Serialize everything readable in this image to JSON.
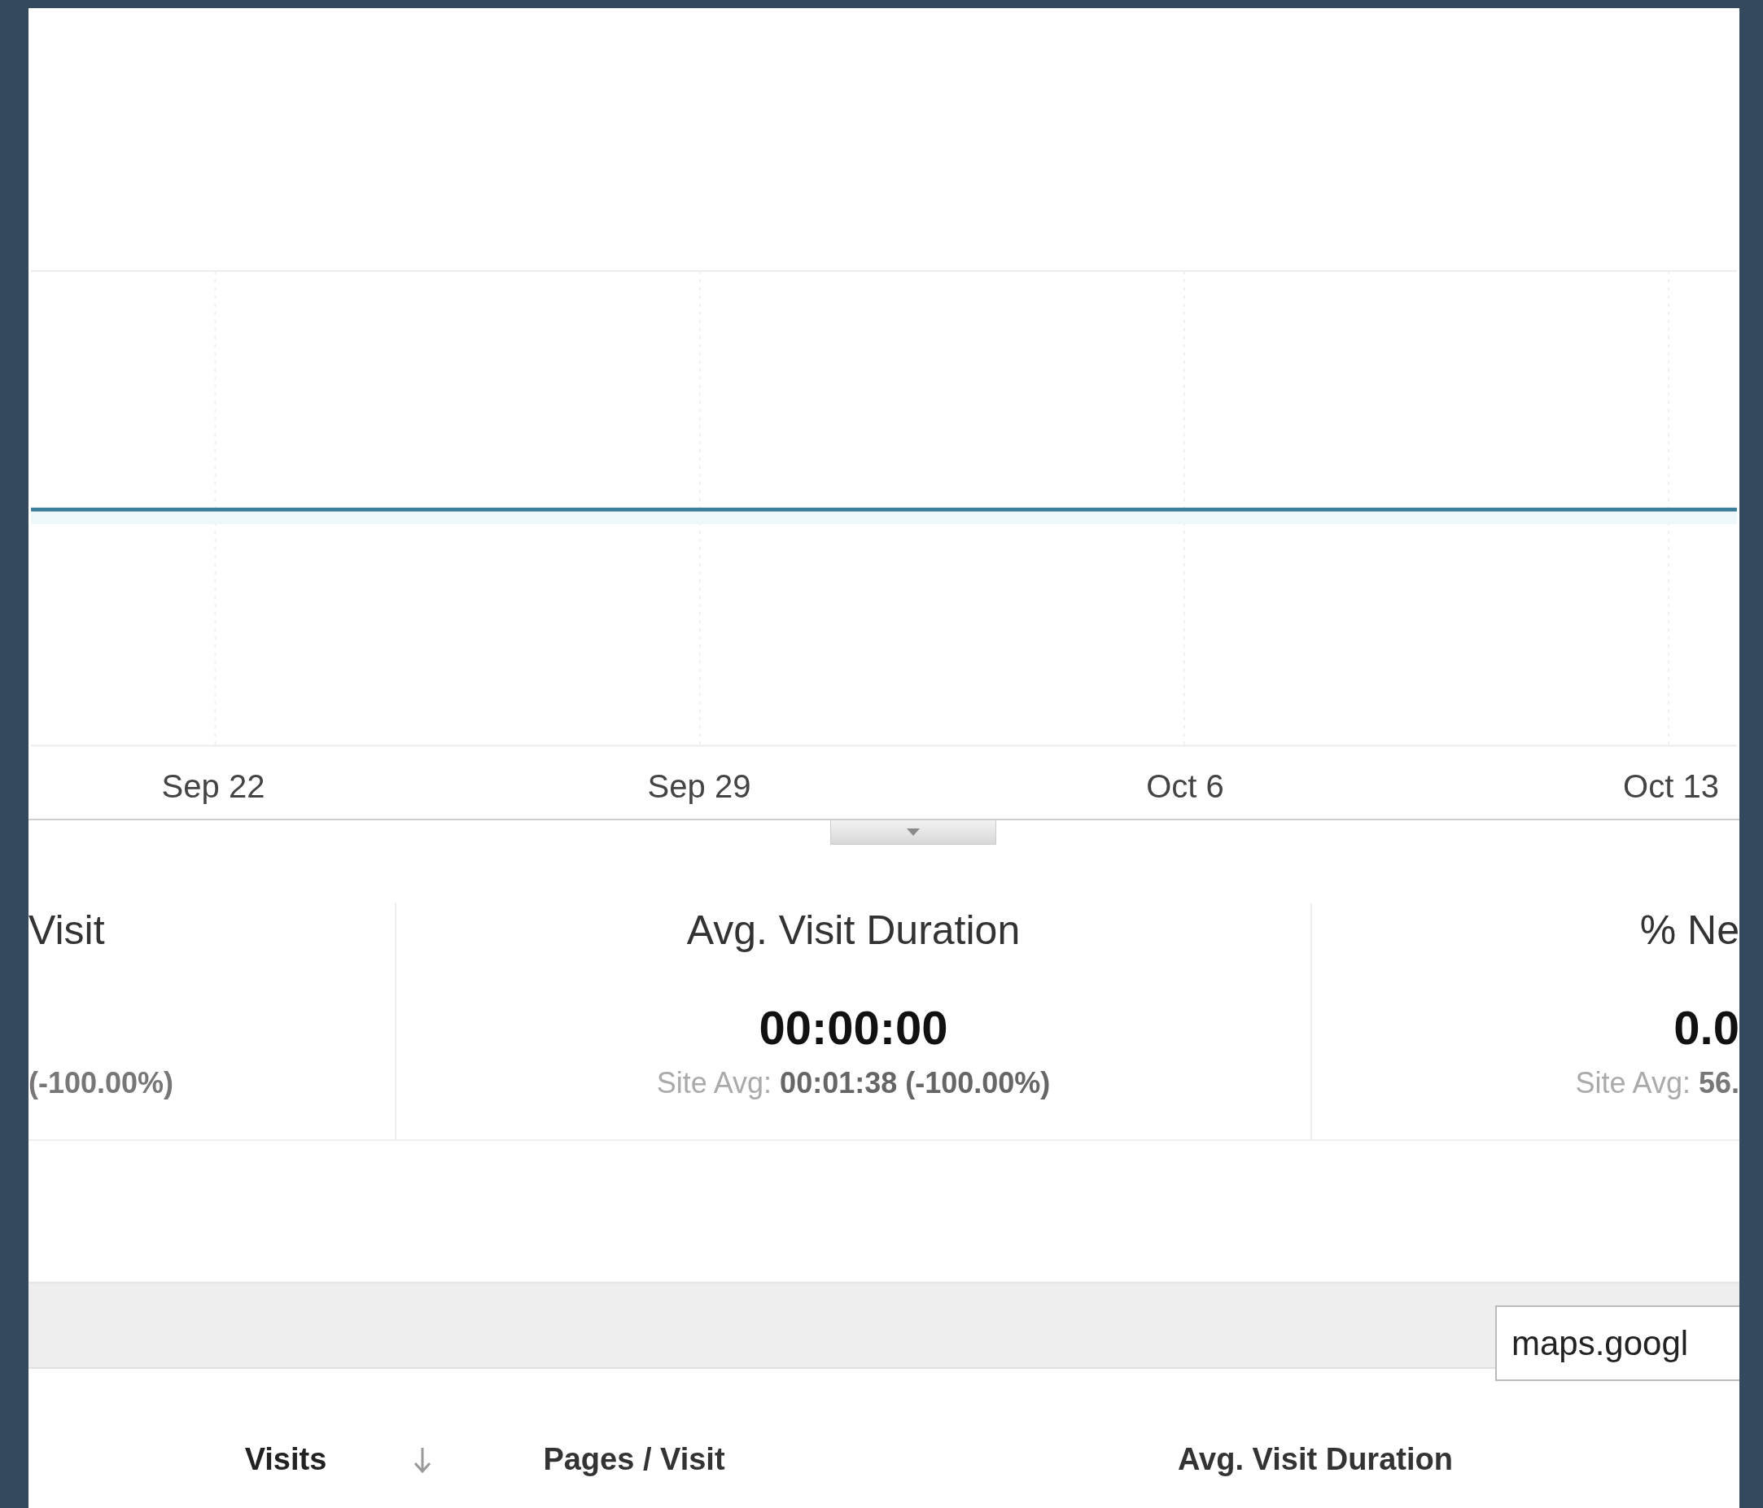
{
  "chart": {
    "x_labels": [
      "Sep 22",
      "Sep 29",
      "Oct 6",
      "Oct 13"
    ]
  },
  "metrics": [
    {
      "title": "Visit",
      "site_avg": "**(-100.00%)**"
    },
    {
      "title": "Avg. Visit Duration",
      "value": "00:00:00",
      "site_avg": "Site Avg: **00:01:38 (-100.00%)**"
    },
    {
      "title": "% Ne",
      "value": "0.0",
      "site_avg": "Site Avg: **56.**"
    }
  ],
  "filter": {
    "value": "maps.googl"
  },
  "table": {
    "columns": [
      {
        "label": "Visits",
        "sorted": true
      },
      {
        "label": "Pages / Visit",
        "sorted": false
      },
      {
        "label": "Avg. Visit Duration",
        "sorted": false
      }
    ]
  }
}
